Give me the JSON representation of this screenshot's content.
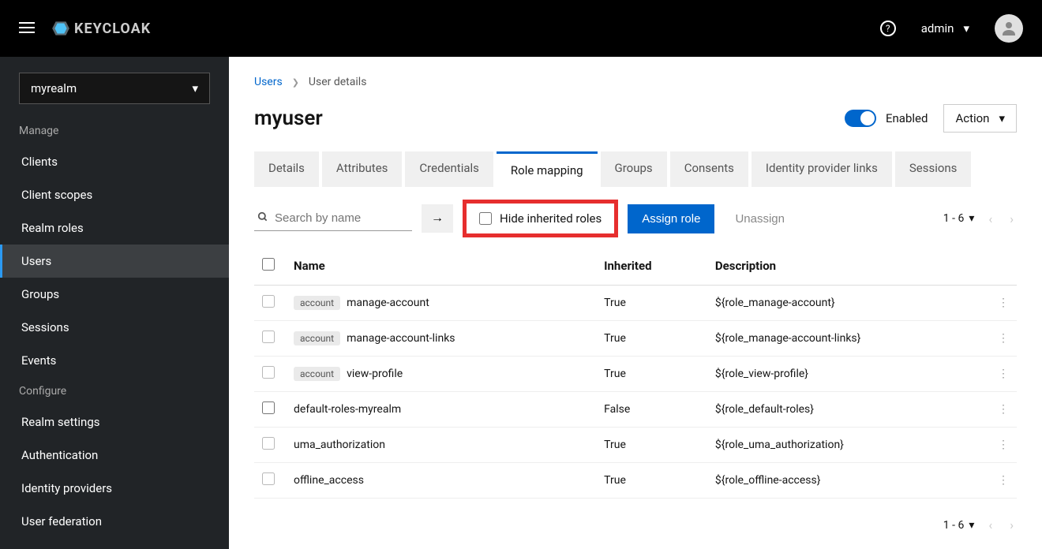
{
  "topbar": {
    "brand": "KEYCLOAK",
    "username": "admin"
  },
  "sidebar": {
    "realm": "myrealm",
    "sections": [
      {
        "title": "Manage",
        "items": [
          "Clients",
          "Client scopes",
          "Realm roles",
          "Users",
          "Groups",
          "Sessions",
          "Events"
        ],
        "activeIndex": 3
      },
      {
        "title": "Configure",
        "items": [
          "Realm settings",
          "Authentication",
          "Identity providers",
          "User federation"
        ]
      }
    ]
  },
  "breadcrumb": {
    "parent": "Users",
    "current": "User details"
  },
  "page": {
    "title": "myuser",
    "enabled_label": "Enabled",
    "action_label": "Action"
  },
  "tabs": [
    "Details",
    "Attributes",
    "Credentials",
    "Role mapping",
    "Groups",
    "Consents",
    "Identity provider links",
    "Sessions"
  ],
  "activeTab": 3,
  "toolbar": {
    "search_placeholder": "Search by name",
    "hide_inherited_label": "Hide inherited roles",
    "assign_label": "Assign role",
    "unassign_label": "Unassign"
  },
  "pagination": {
    "range": "1 - 6"
  },
  "table": {
    "columns": [
      "Name",
      "Inherited",
      "Description"
    ],
    "rows": [
      {
        "badge": "account",
        "name": "manage-account",
        "inherited": "True",
        "description": "${role_manage-account}",
        "selectable": false
      },
      {
        "badge": "account",
        "name": "manage-account-links",
        "inherited": "True",
        "description": "${role_manage-account-links}",
        "selectable": false
      },
      {
        "badge": "account",
        "name": "view-profile",
        "inherited": "True",
        "description": "${role_view-profile}",
        "selectable": false
      },
      {
        "badge": null,
        "name": "default-roles-myrealm",
        "inherited": "False",
        "description": "${role_default-roles}",
        "selectable": true
      },
      {
        "badge": null,
        "name": "uma_authorization",
        "inherited": "True",
        "description": "${role_uma_authorization}",
        "selectable": false
      },
      {
        "badge": null,
        "name": "offline_access",
        "inherited": "True",
        "description": "${role_offline-access}",
        "selectable": false
      }
    ]
  }
}
